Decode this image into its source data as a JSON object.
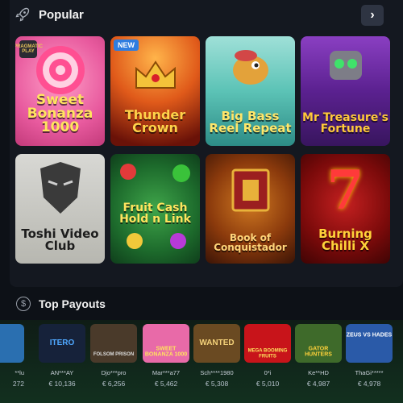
{
  "popular": {
    "title": "Popular",
    "next_label": "›",
    "games": [
      {
        "name": "Sweet Bonanza 1000",
        "badge": "",
        "brand": "PRAGMATIC PLAY"
      },
      {
        "name": "Thunder Crown",
        "badge": "NEW",
        "brand": ""
      },
      {
        "name": "Big Bass Reel Repeat",
        "badge": "",
        "brand": ""
      },
      {
        "name": "Mr Treasure's Fortune",
        "badge": "",
        "brand": ""
      },
      {
        "name": "Toshi Video Club",
        "badge": "",
        "brand": ""
      },
      {
        "name": "Fruit Cash Hold n Link",
        "badge": "",
        "brand": ""
      },
      {
        "name": "Book of Conquistador",
        "badge": "",
        "brand": ""
      },
      {
        "name": "Burning Chilli X",
        "badge": "",
        "brand": ""
      }
    ]
  },
  "top_payouts": {
    "title": "Top Payouts",
    "items": [
      {
        "user": "**lu",
        "amount": "272",
        "game": ""
      },
      {
        "user": "AN***AY",
        "amount": "€ 10,136",
        "game": "ITERO"
      },
      {
        "user": "Djo***pro",
        "amount": "€ 6,256",
        "game": "FOLSOM PRISON"
      },
      {
        "user": "Mar***a77",
        "amount": "€ 5,462",
        "game": "SWEET BONANZA 1000"
      },
      {
        "user": "Sch****1980",
        "amount": "€ 5,308",
        "game": "WANTED"
      },
      {
        "user": "0*i",
        "amount": "€ 5,010",
        "game": "MEGA BOOMING FRUITS"
      },
      {
        "user": "Ke**HD",
        "amount": "€ 4,987",
        "game": "GATOR HUNTERS"
      },
      {
        "user": "ThaGi*****",
        "amount": "€ 4,978",
        "game": "ZEUS VS HADES"
      }
    ]
  }
}
